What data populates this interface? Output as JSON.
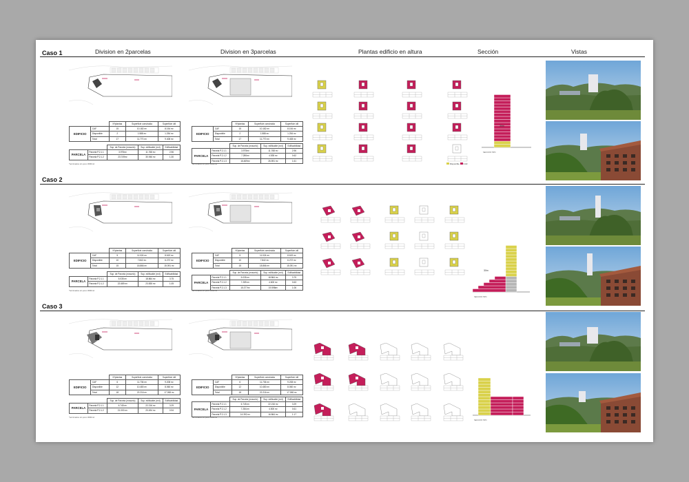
{
  "headers": {
    "col1": "Division en 2parcelas",
    "col2": "Division en 3parcelas",
    "col3": "Plantas edificio en altura",
    "col4": "Sección",
    "col5": "Vistas"
  },
  "colors": {
    "magenta": "#c41e5a",
    "yellow": "#d9d14a",
    "grey": "#b5b5b5"
  },
  "legend": {
    "yellow": "Disponible",
    "magenta": "CAF"
  },
  "note": "*terminados sin poco 3000m2",
  "cases": [
    {
      "label": "Caso 1",
      "t2": {
        "edificio": {
          "title": "EDIFICIO",
          "headers": [
            "Nºplantas",
            "Superficie construida",
            "Superficie útil"
          ],
          "rows": [
            {
              "name": "CAF",
              "v1": "15",
              "v2": "10.182 m²",
              "v3": "8.154 m²"
            },
            {
              "name": "Disponible",
              "v1": "2",
              "v2": "1.588 m²",
              "v3": "1.254 m²"
            },
            {
              "name": "Total",
              "v1": "17",
              "v2": "11.770 m²",
              "v3": "9.408 m²"
            }
          ]
        },
        "parcela": {
          "title": "PARCELA",
          "headers": [
            "Sup. de Parcela (m²suelo)",
            "Sup. edificable (m²t)",
            "Edificabilidad"
          ],
          "rows": [
            {
              "name": "Parcela P.2.1.1",
              "v1": "3.975m²",
              "v2": "11.768 m²",
              "v3": "2.96"
            },
            {
              "name": "Parcela P.2.1.2",
              "v1": "23.749m²",
              "v2": "30.946 m²",
              "v3": "1.30"
            }
          ]
        }
      },
      "t3": {
        "edificio": {
          "title": "EDIFICIO",
          "headers": [
            "Nºplantas",
            "Superficie construida",
            "Superficie útil"
          ],
          "rows": [
            {
              "name": "CAF",
              "v1": "15",
              "v2": "10.182 m²",
              "v3": "8.154 m²"
            },
            {
              "name": "Disponible",
              "v1": "2",
              "v2": "1.588 m²",
              "v3": "1.254 m²"
            },
            {
              "name": "Total",
              "v1": "17",
              "v2": "11.770 m²",
              "v3": "9.408 m²"
            }
          ]
        },
        "parcela": {
          "title": "PARCELA",
          "headers": [
            "Sup. de Parcela (m²suelo)",
            "Sup. edificable (m²t)",
            "Edificabilidad"
          ],
          "rows": [
            {
              "name": "Parcela P.2.1.1",
              "v1": "3.975m²",
              "v2": "11.768 m²",
              "v3": "2.96"
            },
            {
              "name": "Parcela P.2.1.2",
              "v1": "7.280m²",
              "v2": "4.535 m²",
              "v3": "0.62"
            },
            {
              "name": "Parcela P.2.1.3",
              "v1": "16.469m²",
              "v2": "26.591 m²",
              "v3": "1.61"
            }
          ]
        }
      },
      "plans": [
        {
          "label": "Sup. Constr.",
          "sub": "Sup. útil"
        },
        {
          "label": "Sup. Constr.",
          "sub": "Sup. útil"
        },
        {
          "label": "Sup. Constr.",
          "sub": "Sup. útil"
        },
        {
          "label": "Sup. Constr.",
          "sub": "Sup. útil"
        }
      ]
    },
    {
      "label": "Caso 2",
      "t2": {
        "edificio": {
          "title": "EDIFICIO",
          "headers": [
            "Nºplantas",
            "Superficie construida",
            "Superficie útil"
          ],
          "rows": [
            {
              "name": "CAF",
              "v1": "5",
              "v2": "11.024 m²",
              "v3": "8.619 m²"
            },
            {
              "name": "Disponible",
              "v1": "10",
              "v2": "7.842 m²",
              "v3": "6.272 m²"
            },
            {
              "name": "Total",
              "v1": "15",
              "v2": "18.866 m²",
              "v3": "15.091 m²"
            }
          ]
        },
        "parcela": {
          "title": "PARCELA",
          "headers": [
            "Sup. de Parcela (m²suelo)",
            "Sup. edificable (m²t)",
            "Edificabilidad"
          ],
          "rows": [
            {
              "name": "Parcela P.2.1.1",
              "v1": "5.035 m²",
              "v2": "18.864 m²",
              "v3": "3.75"
            },
            {
              "name": "Parcela P.2.1.2",
              "v1": "22.689 m²",
              "v2": "23.835 m²",
              "v3": "1.05"
            }
          ]
        }
      },
      "t3": {
        "edificio": {
          "title": "EDIFICIO",
          "headers": [
            "Nºplantas",
            "Superficie construida",
            "Superficie útil"
          ],
          "rows": [
            {
              "name": "CAF",
              "v1": "5",
              "v2": "11.024 m²",
              "v3": "8.619 m²"
            },
            {
              "name": "Disponible",
              "v1": "10",
              "v2": "7.842 m²",
              "v3": "6.272 m²"
            },
            {
              "name": "Total",
              "v1": "15",
              "v2": "18.866 m²",
              "v3": "15.091 m²"
            }
          ]
        },
        "parcela": {
          "title": "PARCELA",
          "headers": [
            "Sup. de Parcela (m²suelo)",
            "Sup. edificable (m²t)",
            "Edificabilidad"
          ],
          "rows": [
            {
              "name": "Parcela P.2.1.1",
              "v1": "5.035 m²",
              "v2": "18.864 m²",
              "v3": "3.75"
            },
            {
              "name": "Parcela P.2.1.2",
              "v1": "7.289 m²",
              "v2": "4.600 m²",
              "v3": "0.63"
            },
            {
              "name": "Parcela P.2.1.3",
              "v1": "15.377m²",
              "v2": "19.598m²",
              "v3": "1.06"
            }
          ]
        }
      },
      "plans": [
        {
          "label": "Sup. Constr.",
          "sub": "Sup. útil"
        },
        {
          "label": "Sup. Constr.",
          "sub": "Sup. útil"
        },
        {
          "label": "Sup. Constr.",
          "sub": "Sup. útil"
        }
      ]
    },
    {
      "label": "Caso 3",
      "t2": {
        "edificio": {
          "title": "EDIFICIO",
          "headers": [
            "Nºplantas",
            "Superficie construida",
            "Superficie útil"
          ],
          "rows": [
            {
              "name": "CAF",
              "v1": "6",
              "v2": "11.736 m²",
              "v3": "9.208 m²"
            },
            {
              "name": "Disponible",
              "v1": "12",
              "v2": "10.480 m²",
              "v3": "8.060 m²"
            },
            {
              "name": "Total",
              "v1": "18",
              "v2": "22.216 m²",
              "v3": "17.268 m²"
            }
          ]
        },
        "parcela": {
          "title": "PARCELA",
          "headers": [
            "Sup. de Parcela (m²suelo)",
            "Sup. edificable (m²t)",
            "Edificabilidad"
          ],
          "rows": [
            {
              "name": "Parcela P.2.1.1",
              "v1": "6.745 m²",
              "v2": "22.216 m²",
              "v3": "3.29"
            },
            {
              "name": "Parcela P.2.1.2",
              "v1": "21.000 m²",
              "v2": "20.494 m²",
              "v3": "0.94"
            }
          ]
        }
      },
      "t3": {
        "edificio": {
          "title": "EDIFICIO",
          "headers": [
            "Nºplantas",
            "Superficie construida",
            "Superficie útil"
          ],
          "rows": [
            {
              "name": "CAF",
              "v1": "6",
              "v2": "11.736 m²",
              "v3": "9.208 m²"
            },
            {
              "name": "Disponible",
              "v1": "12",
              "v2": "10.480 m²",
              "v3": "8.060 m²"
            },
            {
              "name": "Total",
              "v1": "18",
              "v2": "22.216 m²",
              "v3": "17.268 m²"
            }
          ]
        },
        "parcela": {
          "title": "PARCELA",
          "headers": [
            "Sup. de Parcela (m²suelo)",
            "Sup. edificable (m²t)",
            "Edificabilidad"
          ],
          "rows": [
            {
              "name": "Parcela P.2.1.1",
              "v1": "6.745 m²",
              "v2": "22.216 m²",
              "v3": "3.29"
            },
            {
              "name": "Parcela P.2.1.2",
              "v1": "7.284 m²",
              "v2": "4.500 m²",
              "v3": "0.61"
            },
            {
              "name": "Parcela P.2.1.3",
              "v1": "14.392 m²",
              "v2": "16.864 m²",
              "v3": "1.17"
            }
          ]
        }
      },
      "plans": [
        {
          "label": "Sup. Constr.",
          "sub": "Sup. útil"
        },
        {
          "label": "Sup. Constr.",
          "sub": "Sup. útil"
        },
        {
          "label": "Sup. Constr.",
          "sub": "Sup. útil"
        }
      ]
    }
  ],
  "section": {
    "caption": "SECCION TIPO",
    "height": "30m"
  }
}
